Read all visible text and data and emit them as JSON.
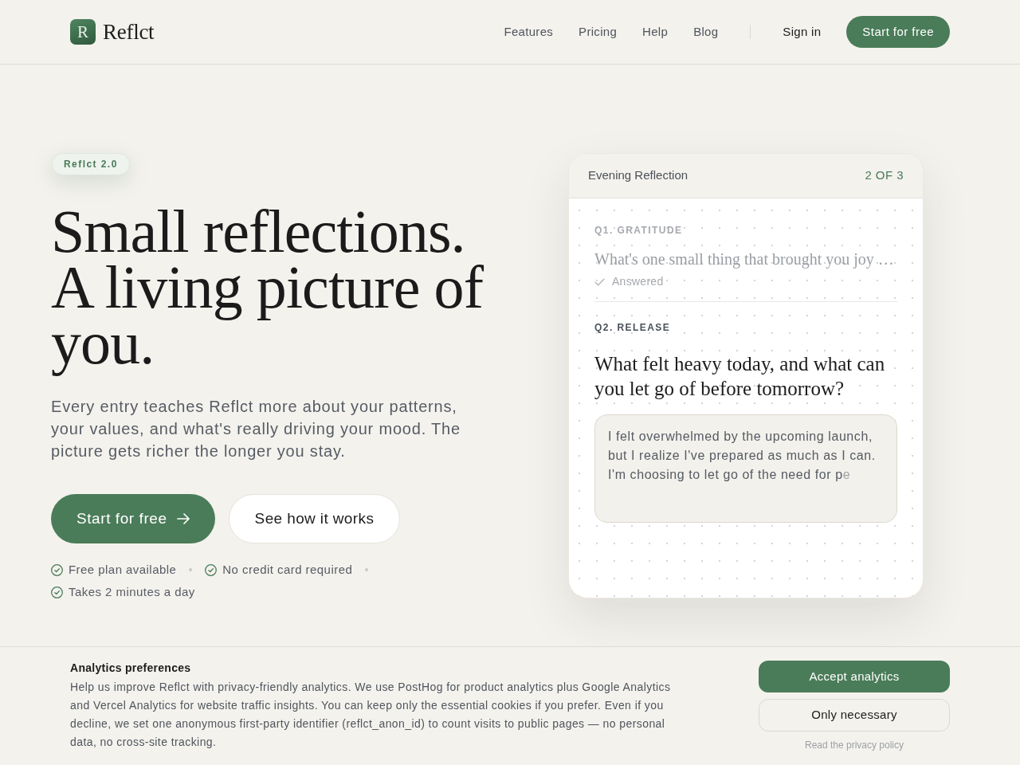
{
  "brand": {
    "logo_letter": "R",
    "name": "Reflct"
  },
  "nav": {
    "links": [
      "Features",
      "Pricing",
      "Help",
      "Blog"
    ],
    "sign_in": "Sign in",
    "cta": "Start for free"
  },
  "hero": {
    "badge": "Reflct 2.0",
    "title": "Small reflections. A living picture of you.",
    "lead": "Every entry teaches Reflct more about your patterns, your values, and what's really driving your mood. The picture gets richer the longer you stay.",
    "primary_button": "Start for free",
    "secondary_button": "See how it works",
    "perks": [
      "Free plan available",
      "No credit card required",
      "Takes 2 minutes a day"
    ]
  },
  "reflection_card": {
    "title": "Evening Reflection",
    "progress": "2 OF 3",
    "questions": [
      {
        "label": "Q1. GRATITUDE",
        "text": "What's one small thing that brought you joy …",
        "answered": true,
        "status": "Answered"
      },
      {
        "label": "Q2. RELEASE",
        "text": "What felt heavy today, and what can you let go of before tomorrow?",
        "answered": false,
        "answer": {
          "value": "I felt overwhelmed by the upcoming launch, but I realize I've prepared as much as I can. I'm choosing to let go of the need for p",
          "typing": "e"
        }
      }
    ]
  },
  "cookie_banner": {
    "title": "Analytics preferences",
    "text": "Help us improve Reflct with privacy-friendly analytics. We use PostHog for product analytics plus Google Analytics and Vercel Analytics for website traffic insights. You can keep only the essential cookies if you prefer. Even if you decline, we set one anonymous first-party identifier (reflct_anon_id) to count visits to public pages — no personal data, no cross-site tracking.",
    "accept_button": "Accept analytics",
    "necessary_button": "Only necessary",
    "policy_link": "Read the privacy policy"
  }
}
